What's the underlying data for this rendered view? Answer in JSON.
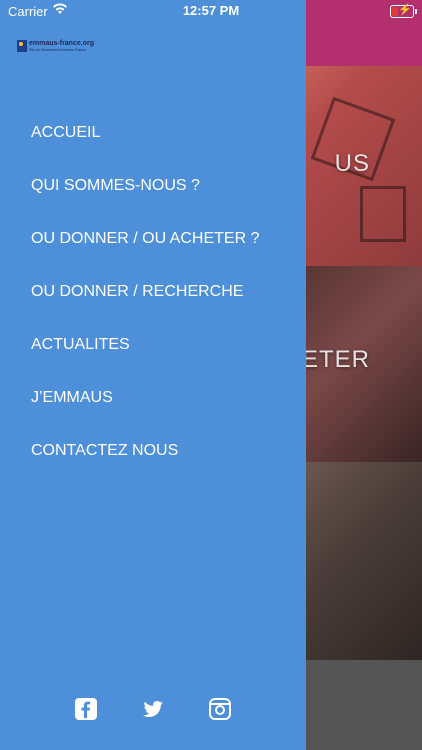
{
  "status_bar": {
    "carrier": "Carrier",
    "time": "12:57 PM"
  },
  "drawer": {
    "logo": {
      "title": "emmaus-france.org",
      "subtitle": "Site du Mouvement Emmaüs France"
    },
    "menu": [
      {
        "label": "ACCUEIL"
      },
      {
        "label": "QUI SOMMES-NOUS ?"
      },
      {
        "label": "OU DONNER / OU ACHETER ?"
      },
      {
        "label": "OU DONNER / RECHERCHE"
      },
      {
        "label": "ACTUALITES"
      },
      {
        "label": "J’EMMAUS"
      },
      {
        "label": "CONTACTEZ NOUS"
      }
    ],
    "social": [
      "facebook-icon",
      "twitter-icon",
      "instagram-icon"
    ]
  },
  "background": {
    "tile1_label": "US",
    "tile2_label": "ETER"
  },
  "colors": {
    "drawer": "#4d8fd8",
    "header": "#b32f6e",
    "text": "#ffffff"
  }
}
